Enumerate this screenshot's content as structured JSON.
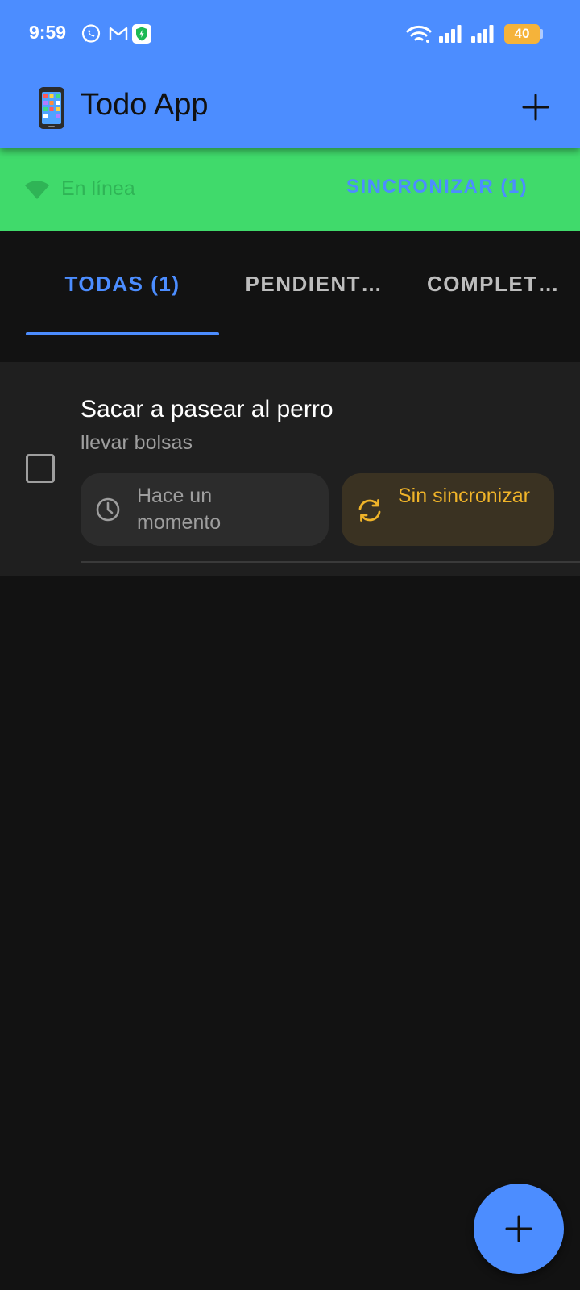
{
  "status_bar": {
    "time": "9:59",
    "battery_level": "40",
    "notification_icons": [
      "whatsapp-icon",
      "gmail-icon",
      "shield-icon"
    ],
    "system_icons": [
      "wifi-icon",
      "signal-icon",
      "signal-icon",
      "battery-icon"
    ]
  },
  "app_bar": {
    "title": "Todo App",
    "emoji_icon": "mobile-phone-icon",
    "action_icon": "plus-icon"
  },
  "connection": {
    "status_label": "En línea",
    "status_icon": "wifi-icon",
    "sync_button_label": "SINCRONIZAR (1)"
  },
  "tabs": [
    {
      "label": "TODAS (1)",
      "selected": true
    },
    {
      "label": "PENDIENT…",
      "selected": false
    },
    {
      "label": "COMPLET…",
      "selected": false
    }
  ],
  "tasks": [
    {
      "title": "Sacar a pasear al perro",
      "description": "llevar bolsas",
      "completed": false,
      "time_label": "Hace un momento",
      "time_icon": "clock-icon",
      "sync_label": "Sin sincronizar",
      "sync_icon": "sync-icon"
    }
  ],
  "fab": {
    "icon": "plus-icon"
  },
  "colors": {
    "primary": "#4C8DFF",
    "online_banner": "#40DA6B",
    "background": "#121212",
    "card": "#1F1F1F",
    "unsynced": "#F0B429",
    "battery": "#F5B33A"
  }
}
